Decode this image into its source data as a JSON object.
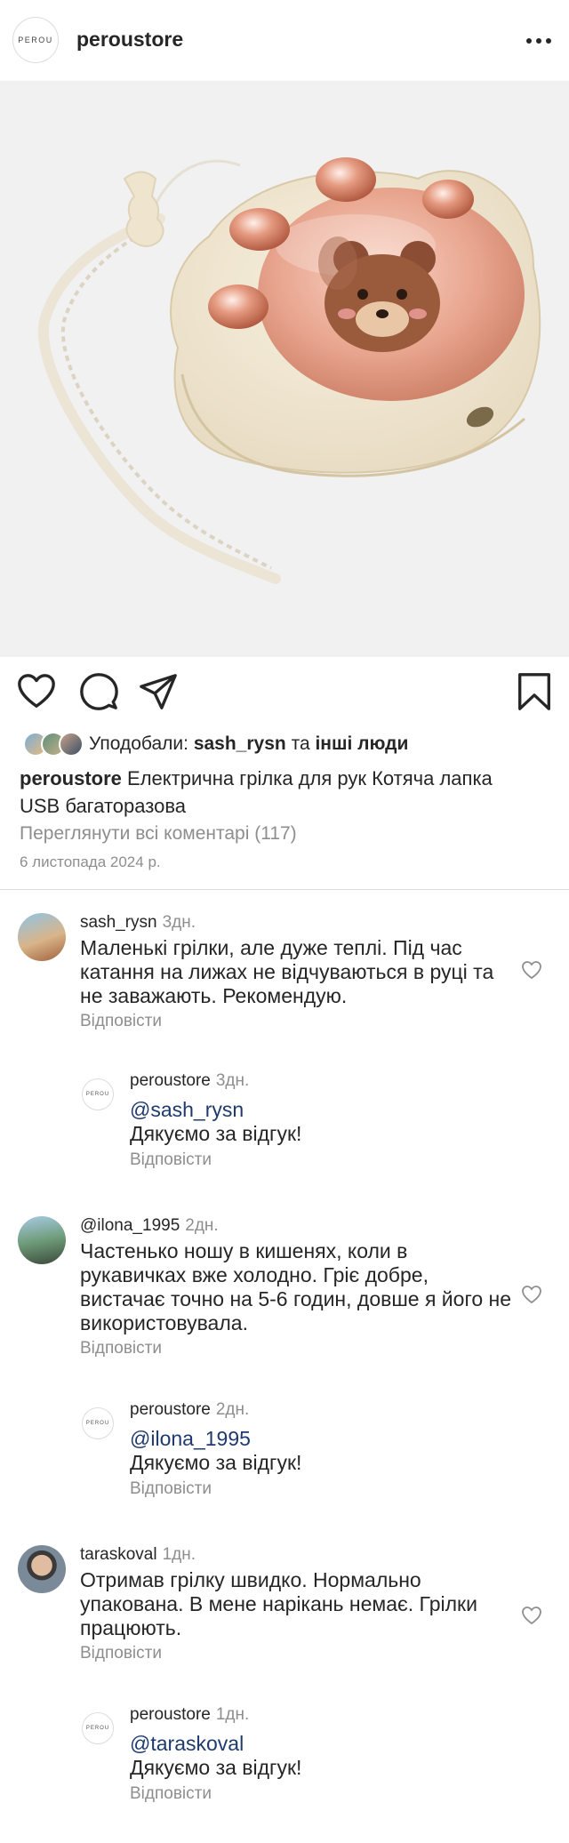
{
  "header": {
    "logo_text": "PEROU",
    "username": "peroustore"
  },
  "post": {
    "liked_by_label": "Уподобали:",
    "liked_by_user": "sash_rysn",
    "liked_by_and": "та",
    "liked_by_others": "інші люди",
    "caption_user": "peroustore",
    "caption_text": "Електрична грілка для рук Котяча лапка USB багаторазова",
    "view_all_comments": "Переглянути всі коментарі (117)",
    "date": "6 листопада 2024 р."
  },
  "comments": [
    {
      "username": "sash_rysn",
      "time": "3дн.",
      "text": "Маленькі грілки, але дуже теплі. Під час катання на лижах не відчуваються в руці та не заважають. Рекомендую.",
      "reply_label": "Відповісти",
      "response": {
        "username": "peroustore",
        "time": "3дн.",
        "mention": "@sash_rysn",
        "text": "Дякуємо за відгук!",
        "reply_label": "Відповісти"
      }
    },
    {
      "username": "@ilona_1995",
      "time": "2дн.",
      "text": "Частенько ношу в кишенях, коли в рукавичках вже холодно. Гріє добре, вистачає точно на 5-6 годин, довше я його не використовувала.",
      "reply_label": "Відповісти",
      "response": {
        "username": "peroustore",
        "time": "2дн.",
        "mention": "@ilona_1995",
        "text": "Дякуємо за відгук!",
        "reply_label": "Відповісти"
      }
    },
    {
      "username": "taraskoval",
      "time": "1дн.",
      "text": "Отримав грілку швидко. Нормально упакована. В мене нарікань немає. Грілки працюють.",
      "reply_label": "Відповісти",
      "response": {
        "username": "peroustore",
        "time": "1дн.",
        "mention": "@taraskoval",
        "text": "Дякуємо за відгук!",
        "reply_label": "Відповісти"
      }
    }
  ],
  "icons": [
    "more-icon",
    "heart-icon",
    "comment-icon",
    "share-icon",
    "bookmark-icon"
  ]
}
